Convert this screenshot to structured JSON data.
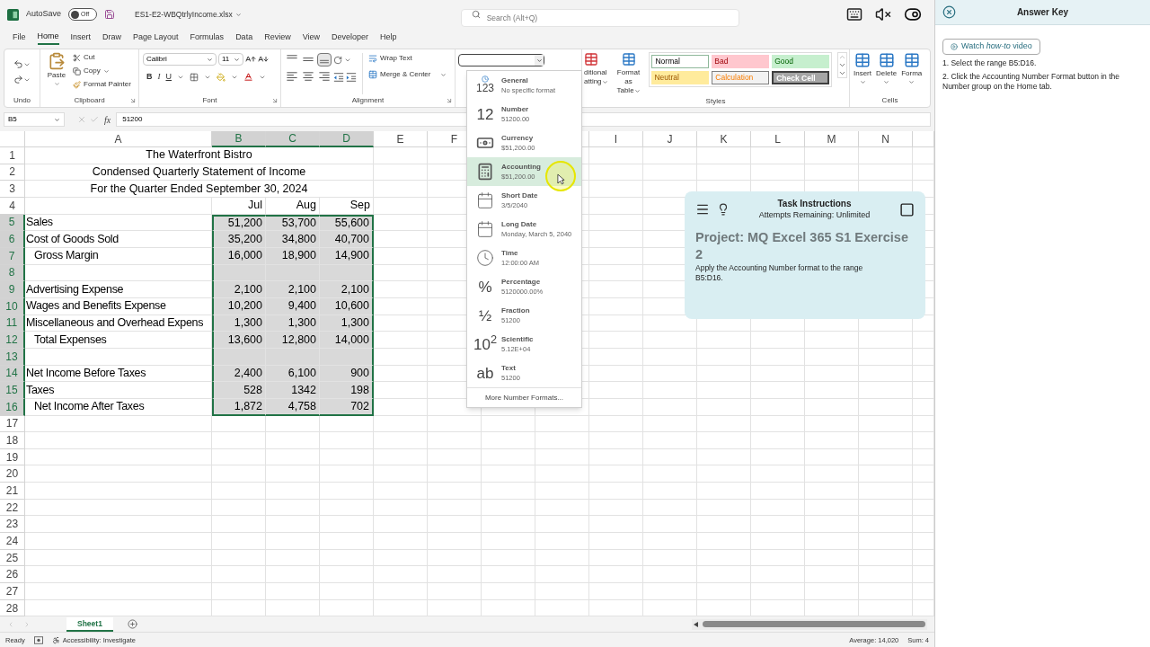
{
  "title_bar": {
    "autosave_label": "AutoSave",
    "autosave": {
      "on": false,
      "label": "Off"
    },
    "filename": "ES1-E2-WBQtrlyIncome.xlsx",
    "search": {
      "placeholder": "Search (Alt+Q)"
    }
  },
  "menu_tabs": [
    {
      "label": "File",
      "selected": false
    },
    {
      "label": "Home",
      "selected": true
    },
    {
      "label": "Insert",
      "selected": false
    },
    {
      "label": "Draw",
      "selected": false
    },
    {
      "label": "Page Layout",
      "selected": false
    },
    {
      "label": "Formulas",
      "selected": false
    },
    {
      "label": "Data",
      "selected": false
    },
    {
      "label": "Review",
      "selected": false
    },
    {
      "label": "View",
      "selected": false
    },
    {
      "label": "Developer",
      "selected": false
    },
    {
      "label": "Help",
      "selected": false
    }
  ],
  "ribbon": {
    "undo": {
      "group": "Undo"
    },
    "clipboard": {
      "paste": "Paste",
      "cut": "Cut",
      "copy": "Copy",
      "format_painter": "Format Painter",
      "group": "Clipboard"
    },
    "font": {
      "name": "Calibri",
      "size": "11",
      "bold": "B",
      "italic": "I",
      "underline": "U",
      "group": "Font"
    },
    "alignment": {
      "vertical": [
        {
          "selected": false
        },
        {
          "selected": false
        },
        {
          "selected": true
        }
      ],
      "wrap_text": "Wrap Text",
      "merge": "Merge & Center",
      "group": "Alignment"
    },
    "styles": {
      "conditional_formatting": [
        "ditional",
        "atting"
      ],
      "format_as_table": [
        "Format as",
        "Table"
      ],
      "cells": [
        {
          "label": "Normal",
          "kind": "normal"
        },
        {
          "label": "Bad",
          "kind": "bad"
        },
        {
          "label": "Good",
          "kind": "good"
        },
        {
          "label": "Neutral",
          "kind": "neutral"
        },
        {
          "label": "Calculation",
          "kind": "calculation"
        },
        {
          "label": "Check Cell",
          "kind": "check"
        }
      ],
      "group": "Styles"
    },
    "cells": {
      "buttons": [
        "Insert",
        "Delete",
        "Forma"
      ],
      "group": "Cells"
    }
  },
  "formula_bar": {
    "name_box": "B5",
    "fx": "fx",
    "value": "51200"
  },
  "sheet": {
    "columns": [
      {
        "kind": "column",
        "label": "A",
        "selected": false
      },
      {
        "kind": "column",
        "label": "B",
        "selected": true
      },
      {
        "kind": "column",
        "label": "C",
        "selected": true
      },
      {
        "kind": "column",
        "label": "D",
        "selected": true
      },
      {
        "kind": "column",
        "label": "E",
        "selected": false
      },
      {
        "kind": "column",
        "label": "F",
        "selected": false
      },
      {
        "kind": "hidden"
      },
      {
        "kind": "covered"
      },
      {
        "kind": "column",
        "label": "I",
        "selected": false
      },
      {
        "kind": "column",
        "label": "J",
        "selected": false
      },
      {
        "kind": "column",
        "label": "K",
        "selected": false
      },
      {
        "kind": "column",
        "label": "L",
        "selected": false
      },
      {
        "kind": "column",
        "label": "M",
        "selected": false
      },
      {
        "kind": "column",
        "label": "N",
        "selected": false
      },
      {
        "kind": "covered"
      }
    ],
    "rows": [
      {
        "number": "1",
        "kind": "title",
        "text": "The Waterfront Bistro",
        "selected": false
      },
      {
        "number": "2",
        "kind": "title",
        "text": "Condensed Quarterly Statement of Income",
        "selected": false
      },
      {
        "number": "3",
        "kind": "title",
        "text": "For the Quarter Ended September 30, 2024",
        "selected": false
      },
      {
        "number": "4",
        "kind": "header",
        "values": [
          "Jul",
          "Aug",
          "Sep"
        ],
        "selected": false
      },
      {
        "number": "5",
        "kind": "data",
        "label": "Sales",
        "indented": false,
        "values": [
          "51,200",
          "53,700",
          "55,600"
        ],
        "selected": true
      },
      {
        "number": "6",
        "kind": "data",
        "label": "Cost of Goods Sold",
        "indented": false,
        "values": [
          "35,200",
          "34,800",
          "40,700"
        ],
        "selected": true
      },
      {
        "number": "7",
        "kind": "data",
        "label": "Gross Margin",
        "indented": true,
        "values": [
          "16,000",
          "18,900",
          "14,900"
        ],
        "selected": true
      },
      {
        "number": "8",
        "kind": "blank",
        "selected": true
      },
      {
        "number": "9",
        "kind": "data",
        "label": "Advertising Expense",
        "indented": false,
        "values": [
          "2,100",
          "2,100",
          "2,100"
        ],
        "selected": true
      },
      {
        "number": "10",
        "kind": "data",
        "label": "Wages and Benefits Expense",
        "indented": false,
        "values": [
          "10,200",
          "9,400",
          "10,600"
        ],
        "selected": true
      },
      {
        "number": "11",
        "kind": "data",
        "label": "Miscellaneous and Overhead Expens",
        "indented": false,
        "values": [
          "1,300",
          "1,300",
          "1,300"
        ],
        "selected": true
      },
      {
        "number": "12",
        "kind": "data",
        "label": "Total Expenses",
        "indented": true,
        "values": [
          "13,600",
          "12,800",
          "14,000"
        ],
        "selected": true
      },
      {
        "number": "13",
        "kind": "blank",
        "selected": true
      },
      {
        "number": "14",
        "kind": "data",
        "label": "Net Income Before Taxes",
        "indented": false,
        "values": [
          "2,400",
          "6,100",
          "900"
        ],
        "selected": true
      },
      {
        "number": "15",
        "kind": "data",
        "label": "Taxes",
        "indented": false,
        "values": [
          "528",
          "1342",
          "198"
        ],
        "selected": true
      },
      {
        "number": "16",
        "kind": "data",
        "label": "Net Income After Taxes",
        "indented": true,
        "values": [
          "1,872",
          "4,758",
          "702"
        ],
        "selected": true
      },
      {
        "number": "17",
        "kind": "blank",
        "selected": false
      },
      {
        "number": "18",
        "kind": "blank",
        "selected": false
      },
      {
        "number": "19",
        "kind": "blank",
        "selected": false
      },
      {
        "number": "20",
        "kind": "blank",
        "selected": false
      },
      {
        "number": "21",
        "kind": "blank",
        "selected": false
      },
      {
        "number": "22",
        "kind": "blank",
        "selected": false
      },
      {
        "number": "23",
        "kind": "blank",
        "selected": false
      },
      {
        "number": "24",
        "kind": "blank",
        "selected": false
      },
      {
        "number": "25",
        "kind": "blank",
        "selected": false
      },
      {
        "number": "26",
        "kind": "blank",
        "selected": false
      },
      {
        "number": "27",
        "kind": "blank",
        "selected": false
      },
      {
        "number": "28",
        "kind": "blank",
        "selected": false
      }
    ]
  },
  "number_format_menu": {
    "items": [
      {
        "name": "General",
        "example": "No specific format",
        "kind": "general",
        "glyph": "123",
        "selected": false
      },
      {
        "name": "Number",
        "example": "51200.00",
        "kind": "glyph",
        "glyph": "12",
        "selected": false
      },
      {
        "name": "Currency",
        "example": "$51,200.00",
        "kind": "currency",
        "selected": false
      },
      {
        "name": "Accounting",
        "example": "$51,200.00",
        "kind": "accounting",
        "selected": true
      },
      {
        "name": "Short Date",
        "example": "3/5/2040",
        "kind": "calendar",
        "selected": false
      },
      {
        "name": "Long Date",
        "example": "Monday, March 5, 2040",
        "kind": "calendar",
        "selected": false
      },
      {
        "name": "Time",
        "example": "12:00:00 AM",
        "kind": "clock",
        "selected": false
      },
      {
        "name": "Percentage",
        "example": "5120000.00%",
        "kind": "glyph",
        "glyph": "%",
        "selected": false
      },
      {
        "name": "Fraction",
        "example": "51200",
        "kind": "glyph",
        "glyph": "½",
        "selected": false
      },
      {
        "name": "Scientific",
        "example": "5.12E+04",
        "kind": "glyph",
        "glyph": "10$^{2}$",
        "selected": false
      },
      {
        "name": "Text",
        "example": "51200",
        "kind": "glyph",
        "glyph": "ab",
        "selected": false
      }
    ],
    "more": "More Number Formats..."
  },
  "task_instructions": {
    "title": "Task Instructions",
    "subtitle": "Attempts Remaining: Unlimited",
    "project": "Project: MQ Excel 365 S1 Exercise 2",
    "instruction": "Apply the Accounting Number format to the range B5:D16."
  },
  "sheet_tabs": [
    {
      "label": "Sheet1",
      "selected": true
    }
  ],
  "status_bar": {
    "mode": "Ready",
    "accessibility": "Accessibility: Investigate",
    "average": "Average: 14,020",
    "sum": "Sum: 4"
  },
  "answer_key": {
    "title": "Answer Key",
    "video_button": "Watch *how-to* video",
    "steps": [
      "1. Select the range B5:D16.",
      "2. Click the Accounting Number Format button in the Number group on the Home tab."
    ]
  }
}
